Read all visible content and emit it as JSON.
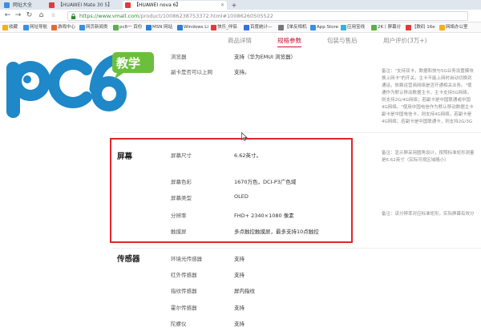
{
  "browser": {
    "tabs": [
      {
        "label": "网址大全",
        "color": "#3b8fe0"
      },
      {
        "label": "【HUAWEI Mate 30 5】",
        "color": "#e03b3b"
      },
      {
        "label": "【HUAWEI nova 6】",
        "color": "#e03b3b"
      }
    ],
    "url_host": "https://www.vmall.com",
    "url_path": "/product/10086238753372.html#10086260505522",
    "bookmarks": [
      {
        "label": "收藏",
        "color": "#f2b01e"
      },
      {
        "label": "网址导航",
        "color": "#3b8fe0"
      },
      {
        "label": "游戏中心",
        "color": "#e06b3b"
      },
      {
        "label": "网页新闻类",
        "color": "#3b8fe0"
      },
      {
        "label": "pc6一 百份",
        "color": "#5ab04a"
      },
      {
        "label": "MSN 网站",
        "color": "#2d7fd0"
      },
      {
        "label": "Windows Li",
        "color": "#2d7fd0"
      },
      {
        "label": "快乐_伴侣",
        "color": "#e03b3b"
      },
      {
        "label": "百度统计—",
        "color": "#3b6fe0"
      },
      {
        "label": "【单反相机",
        "color": "#777777"
      },
      {
        "label": "App Store",
        "color": "#3b8fe0"
      },
      {
        "label": "应用宝线",
        "color": "#3bb0e0"
      },
      {
        "label": "2K丨屏幕分",
        "color": "#5ab04a"
      },
      {
        "label": "【数码 16e",
        "color": "#e03b3b"
      },
      {
        "label": "网络办公室",
        "color": "#f2b01e"
      }
    ]
  },
  "subnav": {
    "tabs": [
      {
        "label": "商品详情",
        "active": false
      },
      {
        "label": "规格参数",
        "active": true
      },
      {
        "label": "包装与售后",
        "active": false
      },
      {
        "label": "用户评价(3万+)",
        "active": false
      }
    ]
  },
  "logo": {
    "text": "pc6",
    "badge": "教学"
  },
  "top_rows": [
    {
      "label": "浏览器",
      "value": "支持（华为EMUI 浏览器）"
    },
    {
      "label": "副卡是否可以上网",
      "value": "支持。"
    }
  ],
  "top_note": [
    "备注：\"支持双卡，数据和快与5G业务设置模块",
    "换上网卡\"的开关，主卡不能上网时自动切换到",
    "通话，依赖运营商网络是否开通相关业务。\"使",
    "通作为默认移动数据主卡，主卡支持5G网络，",
    "则支持2G/4G网络；若副卡是中国联通或中国",
    "4G网络。\"使用中国电信作为默认移动数据主卡",
    "副卡是中国电信卡，则支持4G网络，若副卡是",
    "4G网络；若副卡是中国联通卡，则支持2G/3G"
  ],
  "screen_section": {
    "title": "屏幕",
    "rows": [
      {
        "label": "屏幕尺寸",
        "value": "6.62英寸。"
      },
      {
        "label": "屏幕色彩",
        "value": "1670万色，DCI-P3广色域"
      },
      {
        "label": "屏幕类型",
        "value": "OLED"
      },
      {
        "label": "分辨率",
        "value": "FHD+ 2340×1080 像素"
      },
      {
        "label": "触摸屏",
        "value": "多点触控触摸屏，最多支持10点触控"
      }
    ],
    "note_size": [
      "备注：显示屏采用圆角设计，按照标准矩形测量",
      "是6.62英寸（实际可视区域略小）"
    ],
    "note_resolution": "备注：该分辨率对应标准矩形，实际屏幕有效分"
  },
  "sensor_section": {
    "title": "传感器",
    "rows": [
      {
        "label": "环境光传感器",
        "value": "支持"
      },
      {
        "label": "红外传感器",
        "value": "支持"
      },
      {
        "label": "指纹传感器",
        "value": "屏内指纹"
      },
      {
        "label": "霍尔传感器",
        "value": "支持"
      },
      {
        "label": "陀螺仪",
        "value": "支持"
      }
    ]
  },
  "colors": {
    "accent": "#c8102e",
    "highlight": "#e0262b",
    "logo_blue": "#1e88c8",
    "logo_green": "#6cbf3d"
  }
}
